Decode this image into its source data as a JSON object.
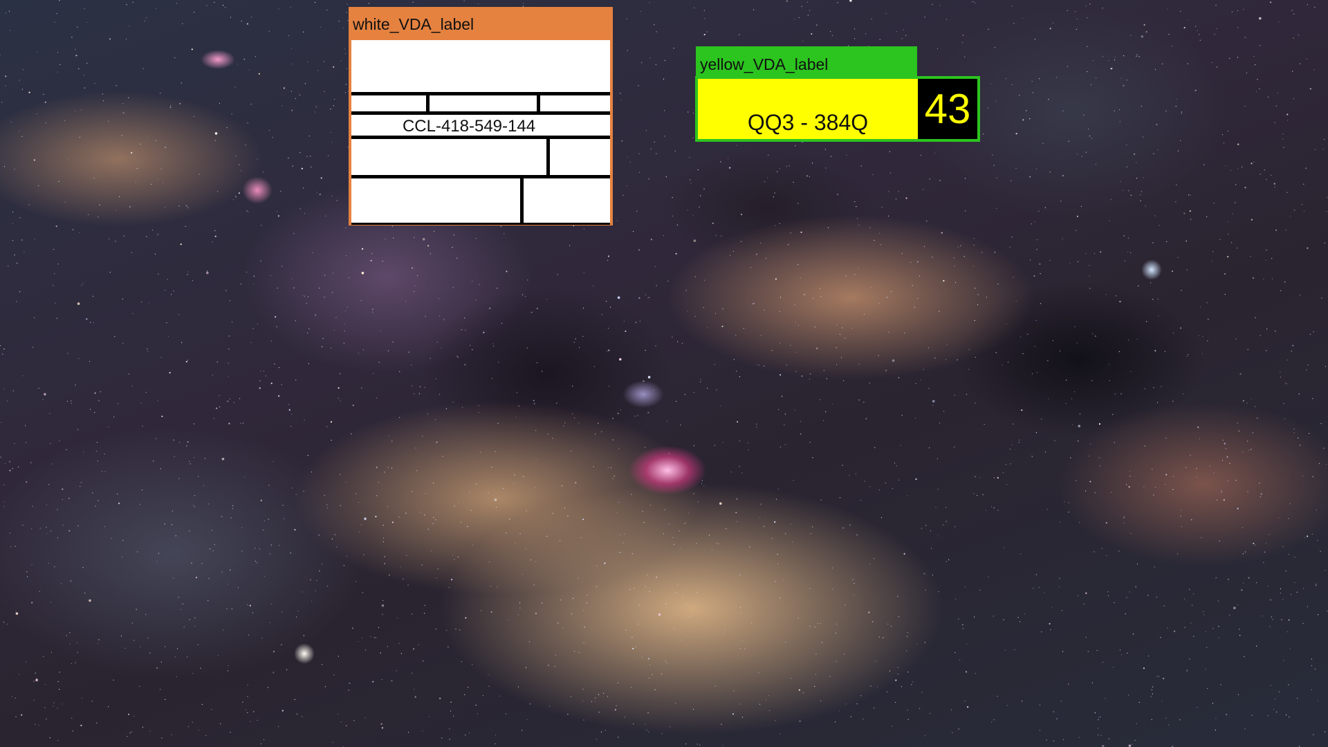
{
  "white_label": {
    "title": "white_VDA_label",
    "code": "CCL-418-549-144",
    "colors": {
      "frame": "#e58240",
      "body": "#ffffff"
    }
  },
  "yellow_label": {
    "title": "yellow_VDA_label",
    "code": "QQ3 - 384Q",
    "number": "43",
    "colors": {
      "frame": "#2cc41f",
      "body": "#ffff00",
      "number_box": "#000000",
      "number_text": "#ffff00"
    }
  },
  "background": {
    "description_icon": "milky-way-starfield"
  }
}
